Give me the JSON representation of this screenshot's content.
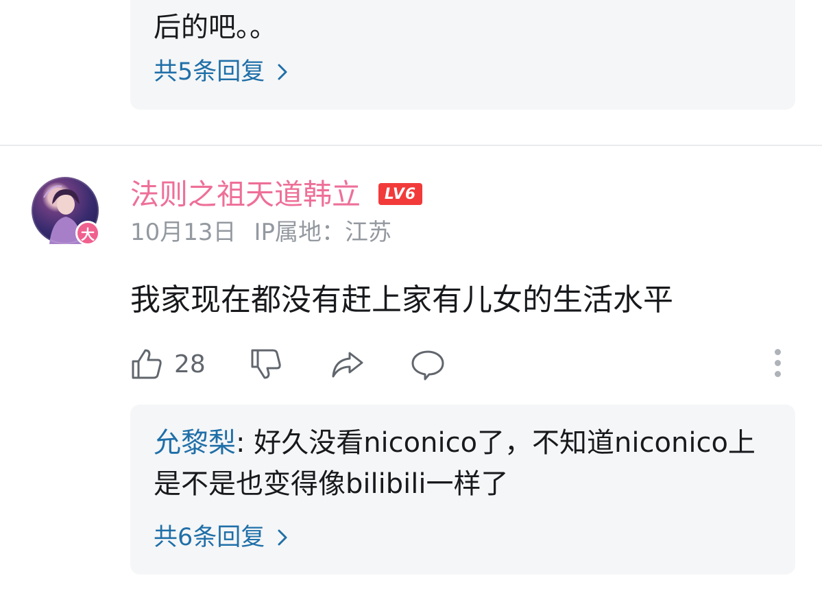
{
  "previous_thread": {
    "text_tail": "后的吧。。",
    "more_replies": "共5条回复"
  },
  "comment": {
    "username": "法则之祖天道韩立",
    "username_color": "#ee6f98",
    "level": "LV6",
    "avatar_badge": "大",
    "date": "10月13日",
    "ip_location": "IP属地：江苏",
    "content": "我家现在都没有赶上家有儿女的生活水平",
    "likes": "28",
    "icons": [
      "thumbs-up-icon",
      "thumbs-down-icon",
      "share-icon",
      "reply-bubble-icon",
      "more-vertical-icon"
    ]
  },
  "sub_reply": {
    "user": "允黎梨",
    "separator": ": ",
    "text": "好久没看niconico了，不知道niconico上是不是也变得像bilibili一样了",
    "more_replies": "共6条回复"
  },
  "colors": {
    "link": "#1f6fa8",
    "level_badge": "#f23a3a",
    "meta": "#9499a0",
    "panel": "#f5f6f7"
  }
}
